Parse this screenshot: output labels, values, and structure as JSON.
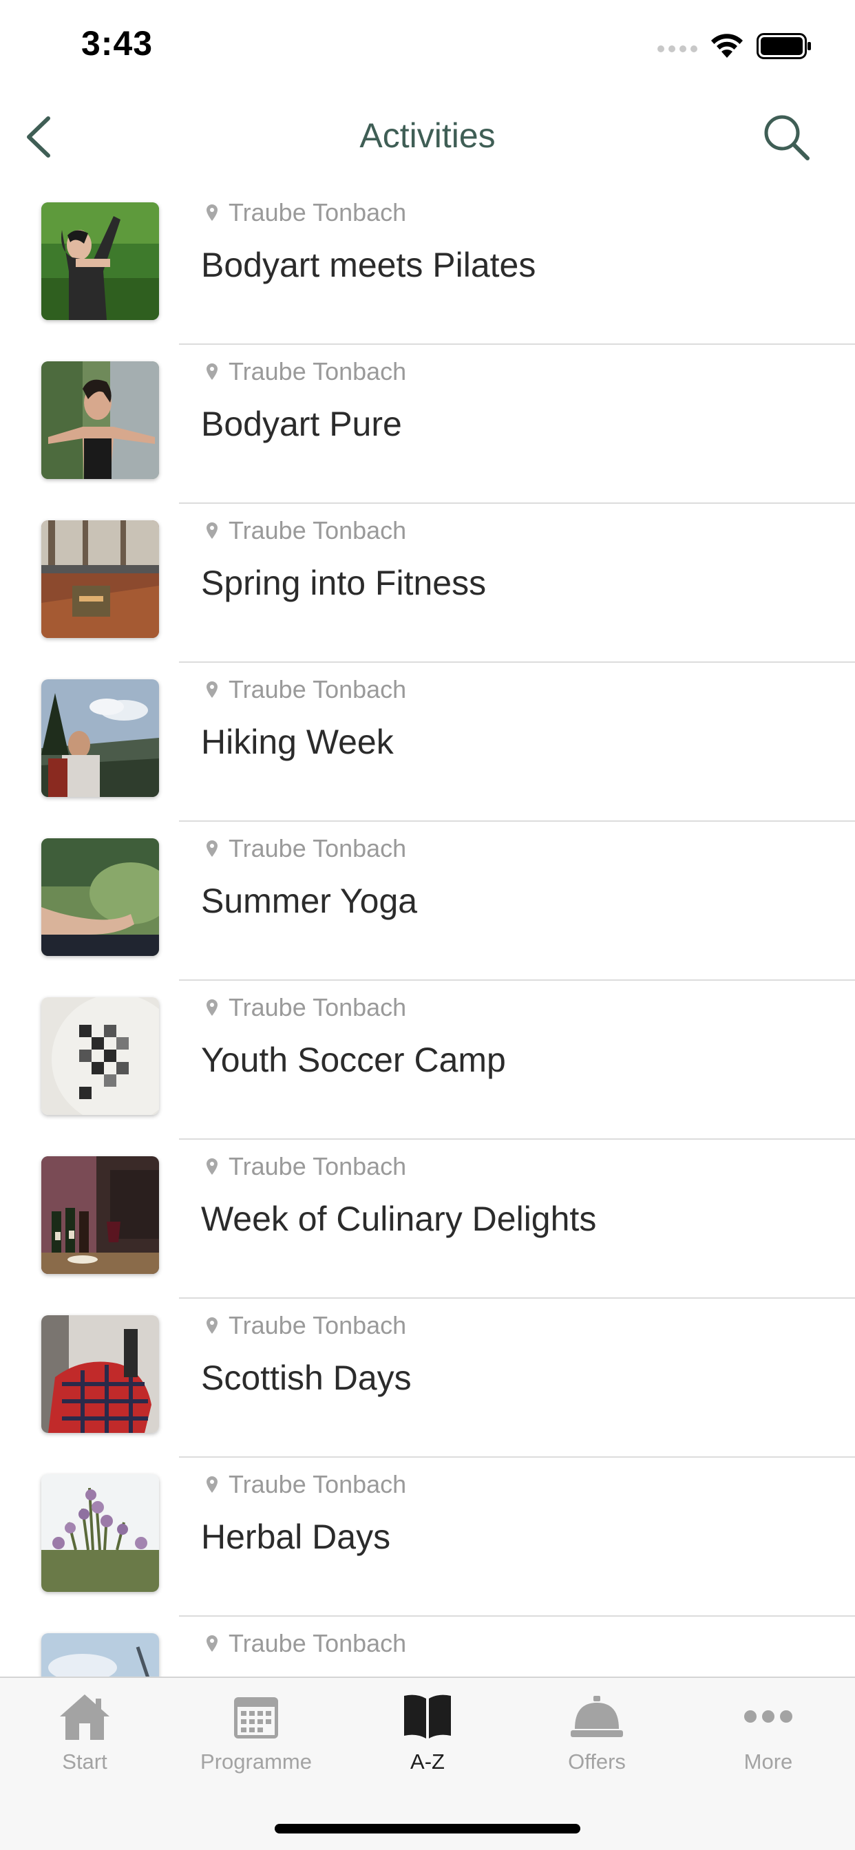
{
  "status_bar": {
    "time": "3:43"
  },
  "nav": {
    "title": "Activities"
  },
  "activities": [
    {
      "location": "Traube Tonbach",
      "title": "Bodyart meets Pilates",
      "image": "woman-stretching-photo"
    },
    {
      "location": "Traube Tonbach",
      "title": "Bodyart Pure",
      "image": "woman-arms-out-photo"
    },
    {
      "location": "Traube Tonbach",
      "title": "Spring into Fitness",
      "image": "fitness-room-photo"
    },
    {
      "location": "Traube Tonbach",
      "title": "Hiking Week",
      "image": "hiker-valley-photo"
    },
    {
      "location": "Traube Tonbach",
      "title": "Summer Yoga",
      "image": "yoga-hand-photo"
    },
    {
      "location": "Traube Tonbach",
      "title": "Youth Soccer Camp",
      "image": "soccer-ball-photo"
    },
    {
      "location": "Traube Tonbach",
      "title": "Week of Culinary Delights",
      "image": "wine-bar-photo"
    },
    {
      "location": "Traube Tonbach",
      "title": "Scottish Days",
      "image": "tartan-bag-photo"
    },
    {
      "location": "Traube Tonbach",
      "title": "Herbal Days",
      "image": "herbs-field-photo"
    },
    {
      "location": "Traube Tonbach",
      "title": "",
      "image": "sky-photo"
    }
  ],
  "tabs": [
    {
      "label": "Start",
      "icon": "house-icon",
      "active": false
    },
    {
      "label": "Programme",
      "icon": "calendar-icon",
      "active": false
    },
    {
      "label": "A-Z",
      "icon": "open-book-icon",
      "active": true
    },
    {
      "label": "Offers",
      "icon": "service-bell-icon",
      "active": false
    },
    {
      "label": "More",
      "icon": "more-dots-icon",
      "active": false
    }
  ],
  "colors": {
    "accent": "#3f5e55",
    "inactive_tab": "#a3a3a3",
    "active_tab": "#1d1d1d",
    "location_text": "#9a9a9a"
  }
}
